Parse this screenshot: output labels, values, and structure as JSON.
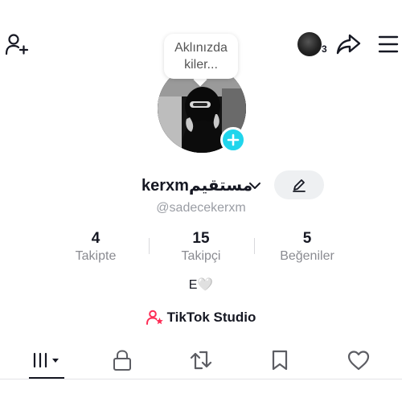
{
  "status_bar": {
    "time": "",
    "signal": ""
  },
  "top_nav": {
    "add_friend_icon": "person-plus-icon",
    "story_count": "3",
    "share_icon": "share-arrow-icon",
    "menu_icon": "hamburger-menu-icon"
  },
  "profile": {
    "note_bubble": "Aklınızda kiler...",
    "display_name": "kerxmمستقيم",
    "username": "@sadecekerxm",
    "bio": "E🤍"
  },
  "stats": [
    {
      "value": "4",
      "label": "Takipte"
    },
    {
      "value": "15",
      "label": "Takipçi"
    },
    {
      "value": "5",
      "label": "Beğeniler"
    }
  ],
  "studio": {
    "label": "TikTok Studio",
    "accent": "#fe2c55"
  },
  "tabs": {
    "items": [
      "videos-grid-icon",
      "lock-icon",
      "repost-icon",
      "bookmark-icon",
      "heart-icon"
    ],
    "active": 0
  },
  "colors": {
    "badge": "#20d5ec",
    "text": "#161823",
    "muted": "#8a8b91"
  }
}
